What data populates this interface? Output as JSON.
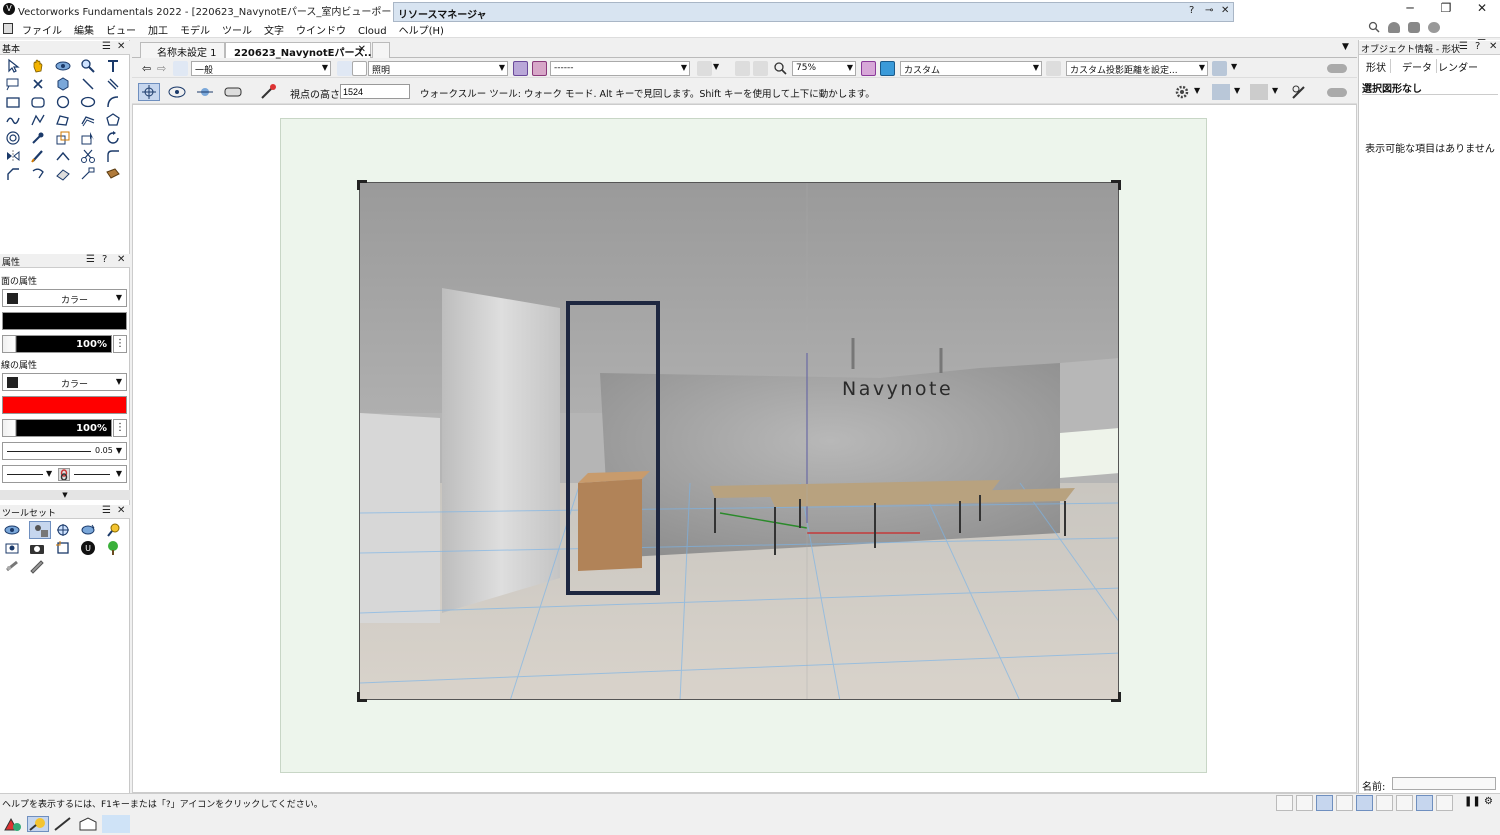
{
  "window": {
    "title": "Vectorworks Fundamentals 2022 - [220623_NavynotEパース_室内ビューポート.vwx]",
    "minimize": "─",
    "restore": "❐",
    "close": "✕"
  },
  "menu": [
    "ファイル",
    "編集",
    "ビュー",
    "加工",
    "モデル",
    "ツール",
    "文字",
    "ウインドウ",
    "Cloud",
    "ヘルプ(H)"
  ],
  "resource_manager": {
    "title": "リソースマネージャ",
    "help": "?",
    "pin": "⊸",
    "close": "✕"
  },
  "basic_palette": {
    "title": "基本"
  },
  "attributes_palette": {
    "title": "属性",
    "fill_section": "面の属性",
    "fill_style": "カラー",
    "fill_color": "#000000",
    "fill_opacity": "100%",
    "line_section": "線の属性",
    "line_style": "カラー",
    "line_color": "#ff0000",
    "line_opacity": "100%",
    "line_weight": "0.05"
  },
  "toolset_palette": {
    "title": "ツールセット"
  },
  "tabs": [
    {
      "label": "名称未設定 1"
    },
    {
      "label": "220623_NavynotEパース..."
    }
  ],
  "viewbar": {
    "class": "一般",
    "layer": "照明",
    "saved_view": "------",
    "zoom": "75%",
    "projection": "カスタム",
    "render_setting": "カスタム投影距離を設定..."
  },
  "modebar": {
    "eye_height_label": "視点の高さ:",
    "eye_height_value": "1524",
    "hint": "ウォークスルー ツール: ウォーク モード. Alt キーで見回します。Shift キーを使用して上下に動かします。"
  },
  "viewport": {
    "sign": "Navynote"
  },
  "info_palette": {
    "title": "オブジェクト情報 - 形状",
    "tabs": [
      "形状",
      "データ",
      "レンダー"
    ],
    "status": "選択図形なし",
    "empty_message": "表示可能な項目はありません",
    "name_label": "名前:"
  },
  "statusbar": {
    "text": "ヘルプを表示するには、F1キーまたは「?」アイコンをクリックしてください。"
  }
}
